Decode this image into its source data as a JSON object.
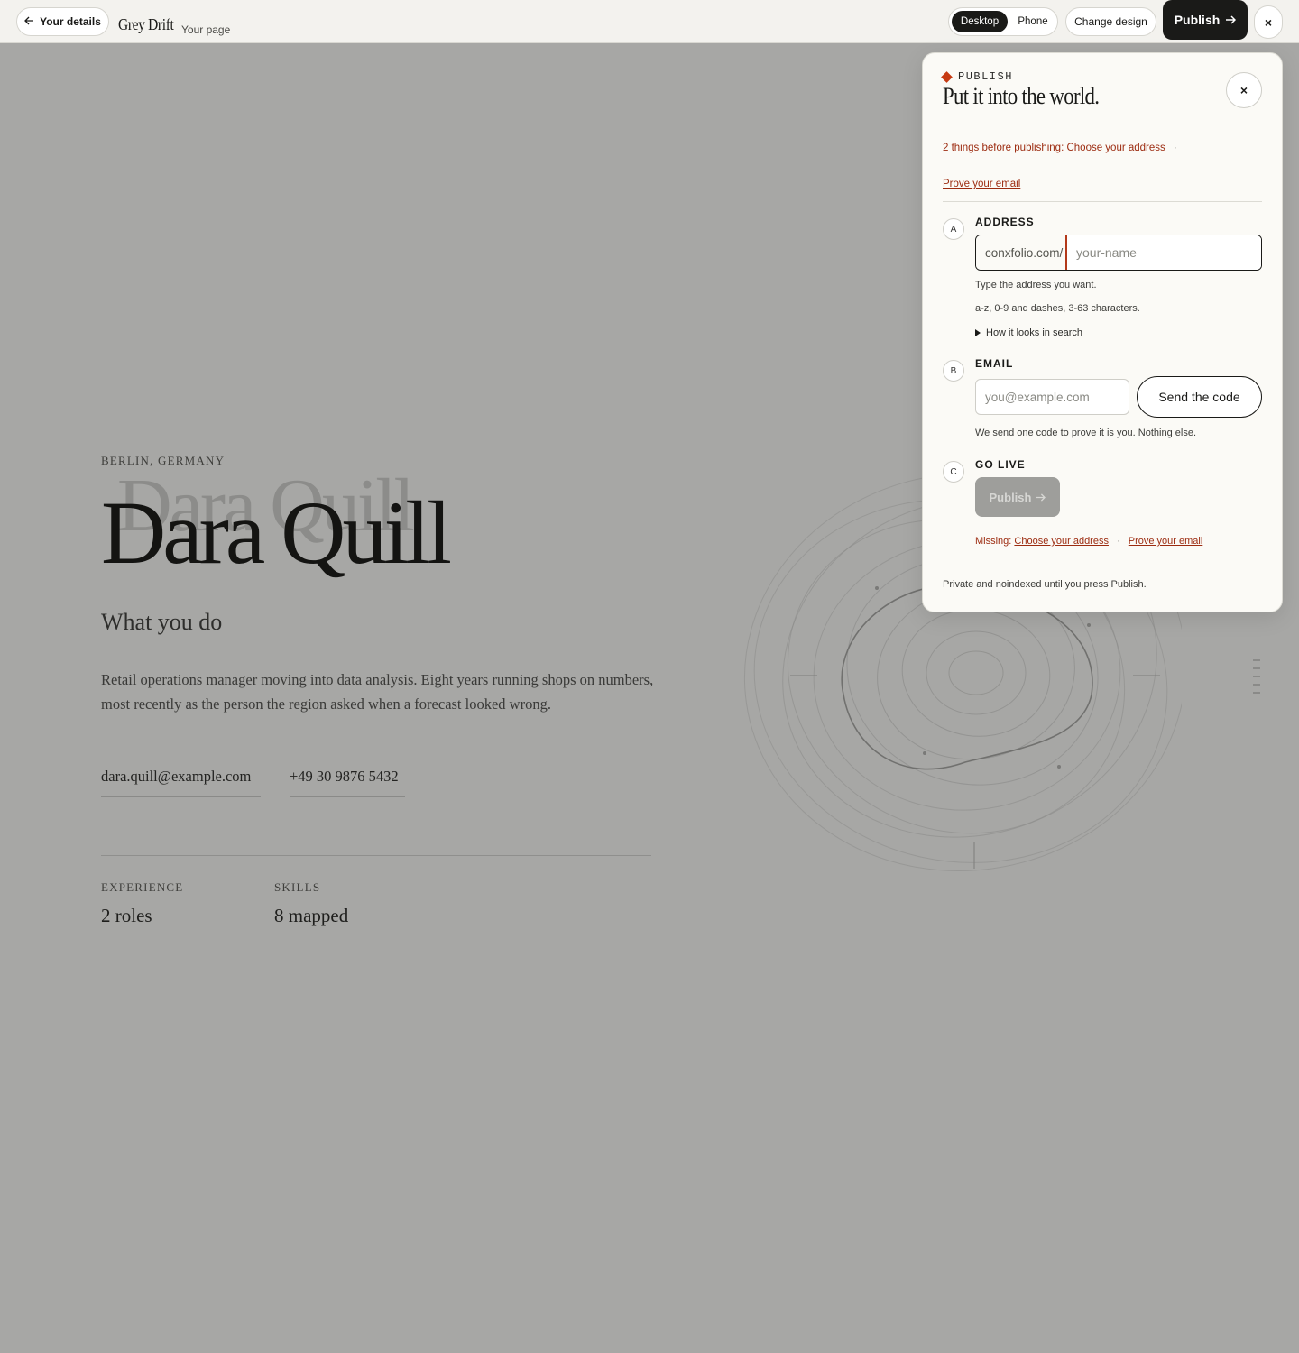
{
  "topbar": {
    "back_label": "Your details",
    "site_name": "Grey Drift",
    "site_sub": "Your page",
    "view_desktop": "Desktop",
    "view_phone": "Phone",
    "view_selected": "Desktop",
    "change_design": "Change design",
    "publish_label": "Publish",
    "close_glyph": "×"
  },
  "page": {
    "location": "BERLIN, GERMANY",
    "name": "Dara Quill",
    "role": "What you do",
    "bio": "Retail operations manager moving into data analysis. Eight years running shops on numbers, most recently as the person the region asked when a forecast looked wrong.",
    "email": "dara.quill@example.com",
    "phone": "+49 30 9876 5432",
    "stats": [
      {
        "label": "EXPERIENCE",
        "value": "2 roles"
      },
      {
        "label": "SKILLS",
        "value": "8 mapped"
      }
    ]
  },
  "panel": {
    "eyebrow": "PUBLISH",
    "title": "Put it into the world.",
    "close_glyph": "×",
    "warning_prefix": "2 things before publishing:",
    "warning_links": [
      "Choose your address",
      "Prove your email"
    ],
    "steps": {
      "address": {
        "badge": "A",
        "label": "ADDRESS",
        "prefix": "conxfolio.com/",
        "placeholder": "your-name",
        "hint1": "Type the address you want.",
        "hint2": "a-z, 0-9 and dashes, 3-63 characters.",
        "disclosure": "How it looks in search"
      },
      "email": {
        "badge": "B",
        "label": "EMAIL",
        "placeholder": "you@example.com",
        "send_label": "Send the code",
        "hint": "We send one code to prove it is you. Nothing else."
      },
      "golive": {
        "badge": "C",
        "label": "GO LIVE",
        "publish_label": "Publish",
        "missing_prefix": "Missing:",
        "missing_links": [
          "Choose your address",
          "Prove your email"
        ]
      }
    },
    "footer": "Private and noindexed until you press Publish."
  },
  "colors": {
    "accent": "#c63a12",
    "warning_text": "#9c2b10",
    "dark": "#1a1a18",
    "backdrop": "#a7a7a5"
  }
}
